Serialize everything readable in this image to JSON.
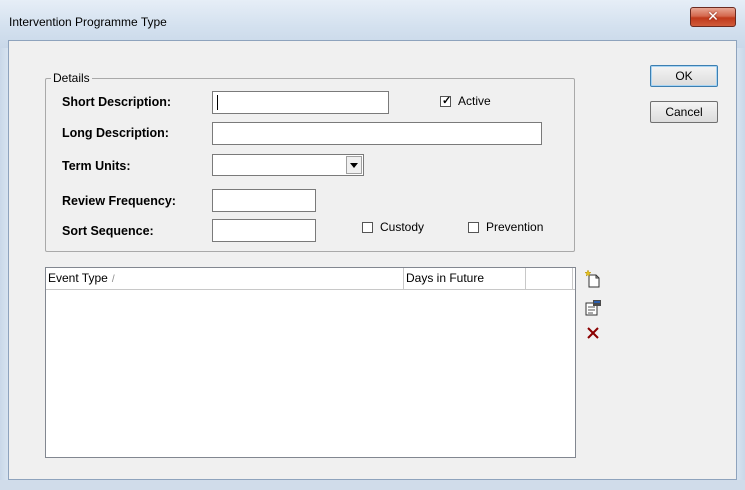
{
  "window": {
    "title": "Intervention Programme Type"
  },
  "buttons": {
    "ok": "OK",
    "cancel": "Cancel"
  },
  "details": {
    "legend": "Details",
    "short_description": {
      "label": "Short Description:",
      "value": ""
    },
    "long_description": {
      "label": "Long Description:",
      "value": ""
    },
    "term_units": {
      "label": "Term Units:",
      "value": ""
    },
    "review_frequency": {
      "label": "Review Frequency:",
      "value": ""
    },
    "sort_sequence": {
      "label": "Sort Sequence:",
      "value": ""
    },
    "active": {
      "label": "Active",
      "checked": true
    },
    "custody": {
      "label": "Custody",
      "checked": false
    },
    "prevention": {
      "label": "Prevention",
      "checked": false
    }
  },
  "events_list": {
    "columns": [
      {
        "label": "Event Type",
        "sort_indicator": "/"
      },
      {
        "label": "Days in Future"
      },
      {
        "label": ""
      }
    ],
    "rows": []
  },
  "toolbar": {
    "icons": [
      "new-item-icon",
      "properties-icon",
      "delete-icon"
    ]
  },
  "colors": {
    "delete": "#8b0000",
    "close_button": "#c0391b"
  }
}
